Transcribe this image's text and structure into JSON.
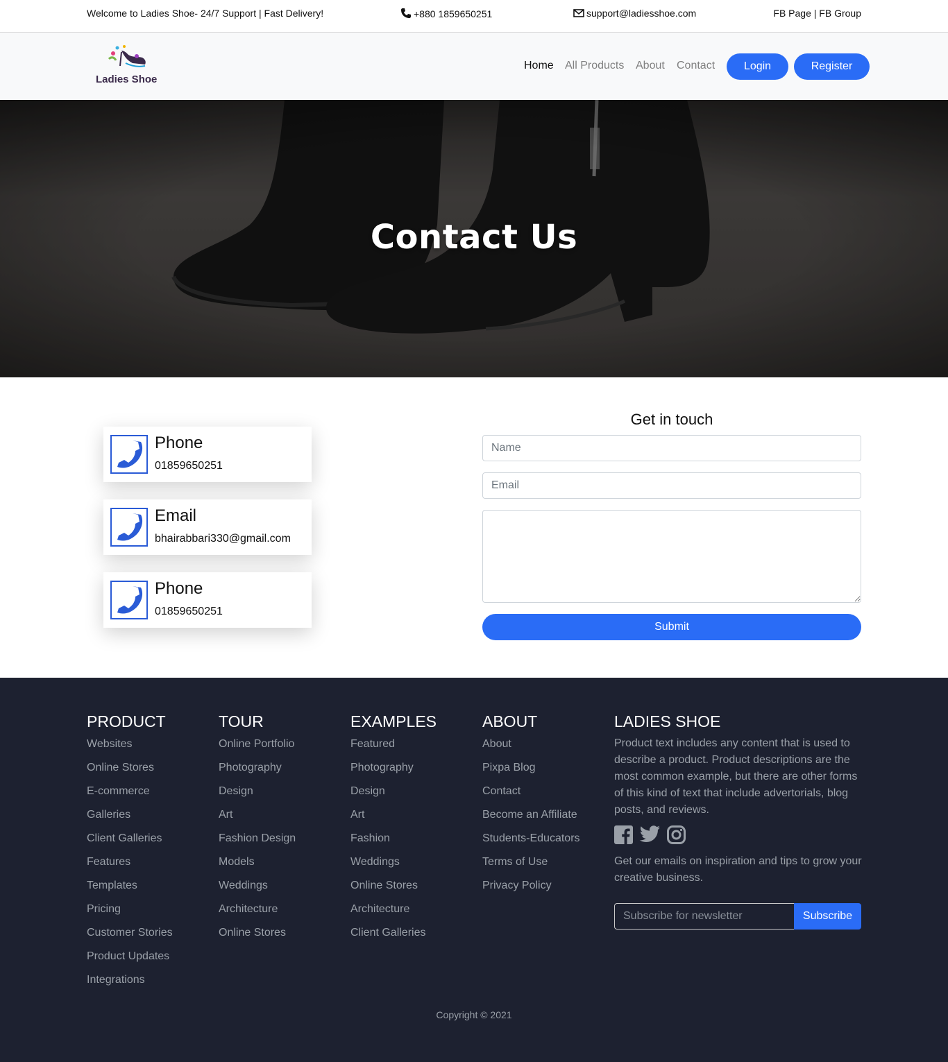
{
  "topbar": {
    "welcome": "Welcome to Ladies Shoe- 24/7 Support | Fast Delivery!",
    "phone": "+880 1859650251",
    "email": "support@ladiesshoe.com",
    "social": "FB Page | FB Group"
  },
  "nav": {
    "logo_text": "Ladies Shoe",
    "links": [
      "Home",
      "All Products",
      "About",
      "Contact"
    ],
    "login": "Login",
    "register": "Register"
  },
  "hero": {
    "title": "Contact Us"
  },
  "contact_cards": [
    {
      "title": "Phone",
      "value": "01859650251"
    },
    {
      "title": "Email",
      "value": "bhairabbari330@gmail.com"
    },
    {
      "title": "Phone",
      "value": "01859650251"
    }
  ],
  "form": {
    "title": "Get in touch",
    "name_placeholder": "Name",
    "email_placeholder": "Email",
    "submit": "Submit"
  },
  "footer": {
    "columns": [
      {
        "heading": "PRODUCT",
        "links": [
          "Websites",
          "Online Stores",
          "E-commerce",
          "Galleries",
          "Client Galleries",
          "Features",
          "Templates",
          "Pricing",
          "Customer Stories",
          "Product Updates",
          "Integrations"
        ]
      },
      {
        "heading": "TOUR",
        "links": [
          "Online Portfolio",
          "Photography",
          "Design",
          "Art",
          "Fashion Design",
          "Models",
          "Weddings",
          "Architecture",
          "Online Stores"
        ]
      },
      {
        "heading": "EXAMPLES",
        "links": [
          "Featured",
          "Photography",
          "Design",
          "Art",
          "Fashion",
          "Weddings",
          "Online Stores",
          "Architecture",
          "Client Galleries"
        ]
      },
      {
        "heading": "ABOUT",
        "links": [
          "About",
          "Pixpa Blog",
          "Contact",
          "Become an Affiliate",
          "Students-Educators",
          "Terms of Use",
          "Privacy Policy"
        ]
      }
    ],
    "brand": {
      "heading": "LADIES SHOE",
      "description": "Product text includes any content that is used to describe a product. Product descriptions are the most common example, but there are other forms of this kind of text that include advertorials, blog posts, and reviews.",
      "social_icons": [
        "facebook-icon",
        "twitter-icon",
        "instagram-icon"
      ],
      "newsletter_text": "Get our emails on inspiration and tips to grow your creative business.",
      "newsletter_placeholder": "Subscribe for newsletter",
      "subscribe": "Subscribe"
    },
    "copyright": "Copyright © 2021"
  },
  "colors": {
    "primary": "#2a6cf6",
    "footer_bg": "#1d2130",
    "navbar_bg": "#f8f9fa",
    "card_icon": "#2a5bd6"
  }
}
